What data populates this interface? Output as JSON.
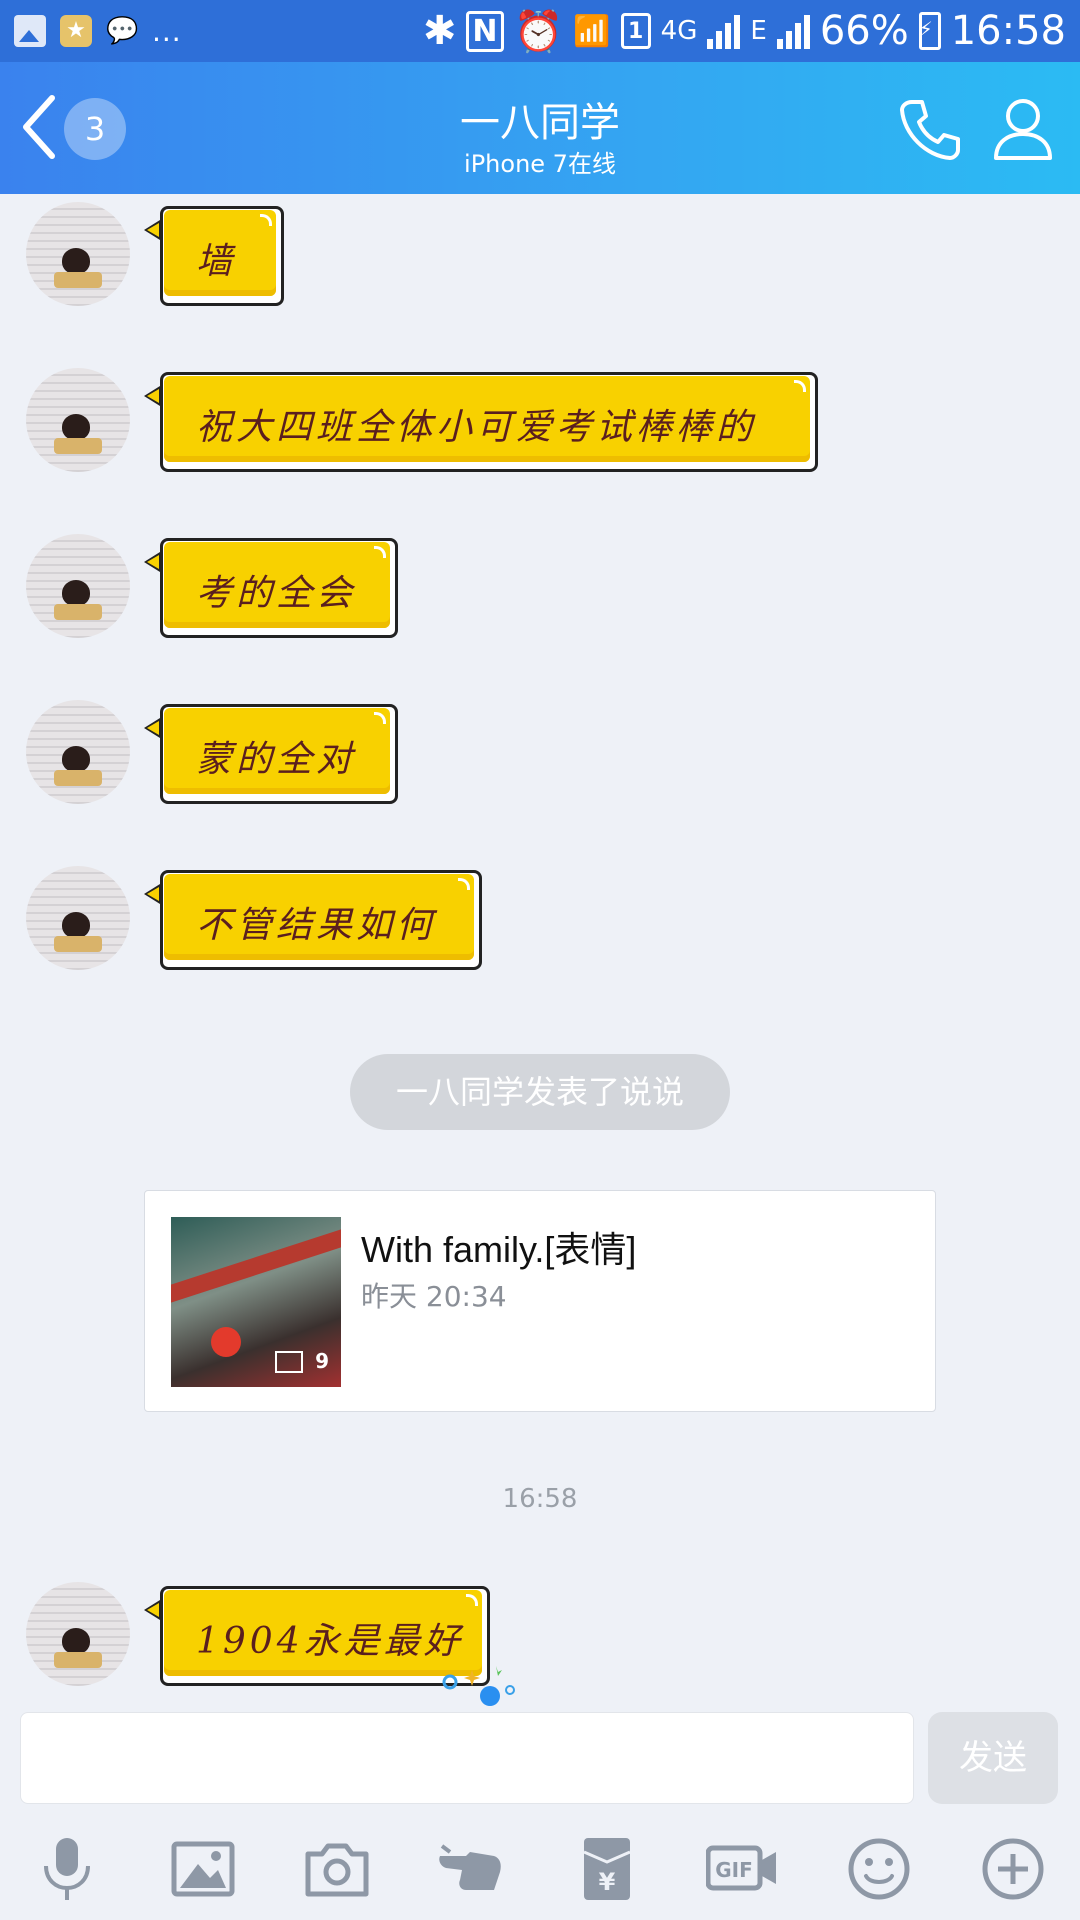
{
  "status_bar": {
    "dots": "...",
    "network_4g": "4G",
    "network_e": "E",
    "sim": "1",
    "battery": "66%",
    "time": "16:58"
  },
  "header": {
    "unread_count": "3",
    "title": "一八同学",
    "subtitle": "iPhone 7在线"
  },
  "messages": [
    {
      "text": "墙"
    },
    {
      "text": "祝大四班全体小可爱考试棒棒的"
    },
    {
      "text": "考的全会"
    },
    {
      "text": "蒙的全对"
    },
    {
      "text": "不管结果如何"
    },
    {
      "text": "1904永是最好"
    }
  ],
  "system_notice": "一八同学发表了说说",
  "share_card": {
    "title": "With family.[表情]",
    "time": "昨天 20:34",
    "photo_count": "9"
  },
  "timestamp": "16:58",
  "composer": {
    "send_label": "发送"
  },
  "toolbar": {
    "icons": [
      "microphone-icon",
      "image-icon",
      "camera-icon",
      "poke-hand-icon",
      "red-packet-icon",
      "gif-icon",
      "emoji-icon",
      "plus-icon"
    ],
    "gif_label": "GIF"
  },
  "colors": {
    "header_start": "#3a82ee",
    "header_end": "#2bbbf3",
    "bubble_yellow": "#f8d100",
    "bubble_text": "#5a1f1f",
    "background": "#eef1f7"
  }
}
